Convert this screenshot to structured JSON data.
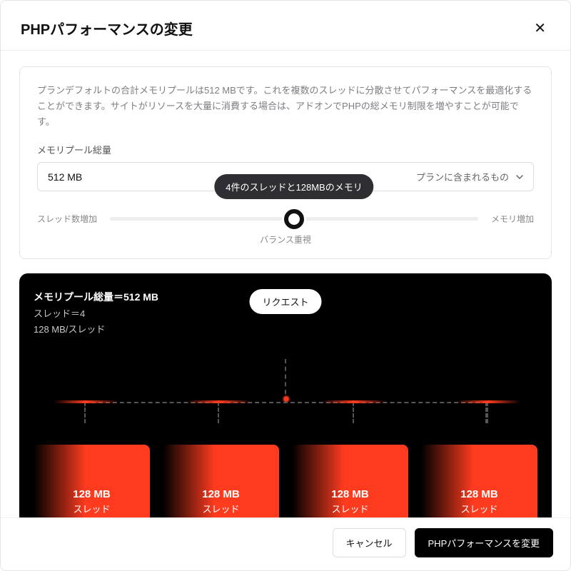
{
  "header": {
    "title": "PHPパフォーマンスの変更",
    "close_label": "✕"
  },
  "config": {
    "description": "プランデフォルトの合計メモリプールは512 MBです。これを複数のスレッドに分散させてパフォーマンスを最適化することができます。サイトがリソースを大量に消費する場合は、アドオンでPHPの総メモリ制限を増やすことが可能です。",
    "pool_label": "メモリプール総量",
    "pool_value": "512 MB",
    "pool_plan_text": "プランに含まれるもの"
  },
  "slider": {
    "left_label": "スレッド数増加",
    "right_label": "メモリ増加",
    "center_label": "バランス重視",
    "tooltip": "4件のスレッドと128MBのメモリ"
  },
  "vis": {
    "header_line": "メモリプール総量＝512 MB",
    "line2": "スレッド＝4",
    "line3": "128 MB/スレッド",
    "request_label": "リクエスト",
    "thread_mb": "128 MB",
    "thread_sub": "スレッド"
  },
  "footer": {
    "cancel": "キャンセル",
    "apply": "PHPパフォーマンスを変更"
  }
}
